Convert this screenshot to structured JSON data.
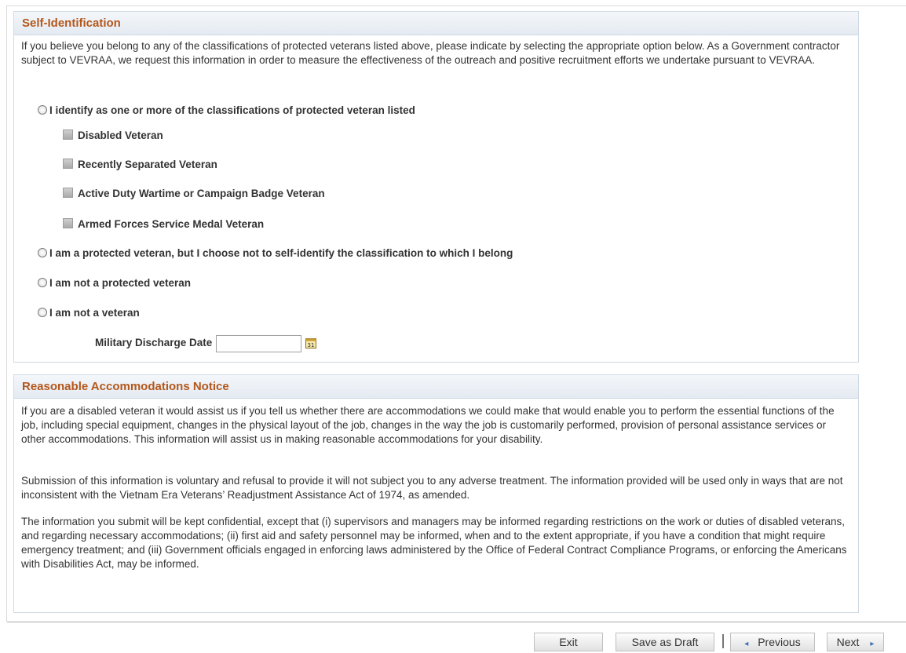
{
  "self_identification": {
    "title": "Self-Identification",
    "intro": "If you believe you belong to any of the classifications of protected veterans listed above, please indicate by selecting the appropriate option below. As a Government contractor subject to VEVRAA, we request this information in order to measure the effectiveness of the outreach and positive recruitment efforts we undertake pursuant to VEVRAA.",
    "options": [
      "I identify as one or more of the classifications of protected veteran listed",
      "I am a protected veteran, but I choose not to self-identify the classification to which I belong",
      "I am not a protected veteran",
      "I am not a veteran"
    ],
    "classifications": [
      "Disabled Veteran",
      "Recently Separated Veteran",
      "Active Duty Wartime or Campaign Badge Veteran",
      "Armed Forces Service Medal Veteran"
    ],
    "discharge_date_label": "Military Discharge Date",
    "discharge_date_value": ""
  },
  "accommodations": {
    "title": "Reasonable Accommodations Notice",
    "paragraphs": [
      "If you are a disabled veteran it would assist us if you tell us whether there are accommodations we could make that would enable you to perform the essential functions of the job, including special equipment, changes in the physical layout of the job, changes in the way the job is customarily performed, provision of personal assistance services or other accommodations. This information will assist us in making reasonable accommodations for your disability.",
      "Submission of this information is voluntary and refusal to provide it will not subject you to any adverse treatment. The information provided will be used only in ways that are not inconsistent with the Vietnam Era Veterans’ Readjustment Assistance Act of 1974, as amended.",
      "The information you submit will be kept confidential, except that (i) supervisors and managers may be informed regarding restrictions on the work or duties of disabled veterans, and regarding necessary accommodations; (ii) first aid and safety personnel may be informed, when and to the extent appropriate, if you have a condition that might require emergency treatment; and (iii) Government officials engaged in enforcing laws administered by the Office of Federal Contract Compliance Programs, or enforcing the Americans with Disabilities Act, may be informed."
    ]
  },
  "footer": {
    "exit": "Exit",
    "save_draft": "Save as Draft",
    "previous": "Previous",
    "next": "Next",
    "previous_icon": "◂",
    "next_icon": "▸"
  },
  "icons": {
    "calendar": "calendar-icon",
    "radio": "radio-button",
    "checkbox": "checkbox-disabled"
  },
  "colors": {
    "section_title": "#b4571b",
    "header_bg": "#e4eaf1",
    "border": "#cfd9e3",
    "arrow": "#3b6fb6"
  }
}
